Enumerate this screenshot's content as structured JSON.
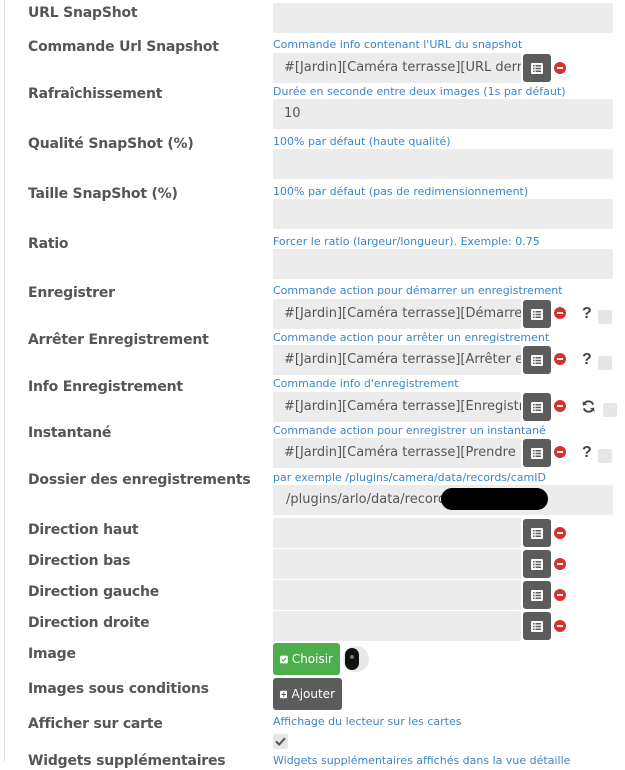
{
  "fields": {
    "url_snapshot": {
      "label": "URL SnapShot",
      "value": ""
    },
    "cmd_url_snapshot": {
      "label": "Commande Url Snapshot",
      "hint": "Commande info contenant l'URL du snapshot",
      "value": "#[Jardin][Caméra terrasse][URL dernière ca"
    },
    "refresh": {
      "label": "Rafraîchissement",
      "hint": "Durée en seconde entre deux images (1s par défaut)",
      "value": "10"
    },
    "quality": {
      "label": "Qualité SnapShot (%)",
      "hint": "100% par défaut (haute qualité)",
      "value": ""
    },
    "size": {
      "label": "Taille SnapShot (%)",
      "hint": "100% par défaut (pas de redimensionnement)",
      "value": ""
    },
    "ratio": {
      "label": "Ratio",
      "hint": "Forcer le ratio (largeur/longueur). Exemple: 0.75",
      "value": ""
    },
    "record": {
      "label": "Enregistrer",
      "hint": "Commande action pour démarrer un enregistrement",
      "value": "#[Jardin][Caméra terrasse][Démarrer enreg"
    },
    "stop_record": {
      "label": "Arrêter Enregistrement",
      "hint": "Commande action pour arrêter un enregistrement",
      "value": "#[Jardin][Caméra terrasse][Arrêter enregist"
    },
    "info_record": {
      "label": "Info Enregistrement",
      "hint": "Commande info d'enregistrement",
      "value": "#[Jardin][Caméra terrasse][Enregistrement]"
    },
    "snapshot": {
      "label": "Instantané",
      "hint": "Commande action pour enregistrer un instantané",
      "value": "#[Jardin][Caméra terrasse][Prendre une cap"
    },
    "records_dir": {
      "label": "Dossier des enregistrements",
      "hint": "par exemple /plugins/camera/data/records/camID",
      "value": "/plugins/arlo/data/records"
    },
    "dir_up": {
      "label": "Direction haut",
      "value": ""
    },
    "dir_down": {
      "label": "Direction bas",
      "value": ""
    },
    "dir_left": {
      "label": "Direction gauche",
      "value": ""
    },
    "dir_right": {
      "label": "Direction droite",
      "value": ""
    },
    "image": {
      "label": "Image",
      "button": "Choisir"
    },
    "conditional_images": {
      "label": "Images sous conditions",
      "button": "Ajouter"
    },
    "show_on_map": {
      "label": "Afficher sur carte",
      "hint": "Affichage du lecteur sur les cartes",
      "checked": true
    },
    "extra_widgets": {
      "label": "Widgets supplémentaires",
      "hint": "Widgets supplémentaires affichés dans la vue détaille"
    }
  },
  "icons": {
    "list": "list-icon",
    "remove": "minus-circle-icon",
    "help": "question-mark-icon",
    "refresh": "refresh-icon",
    "check": "check-icon",
    "plus": "plus-square-icon"
  },
  "colors": {
    "label": "#555555",
    "hint": "#3b86c9",
    "input_bg": "#ececec",
    "action_btn": "#5c5c5c",
    "remove": "#d9302c",
    "choose_btn": "#4cae4c"
  }
}
